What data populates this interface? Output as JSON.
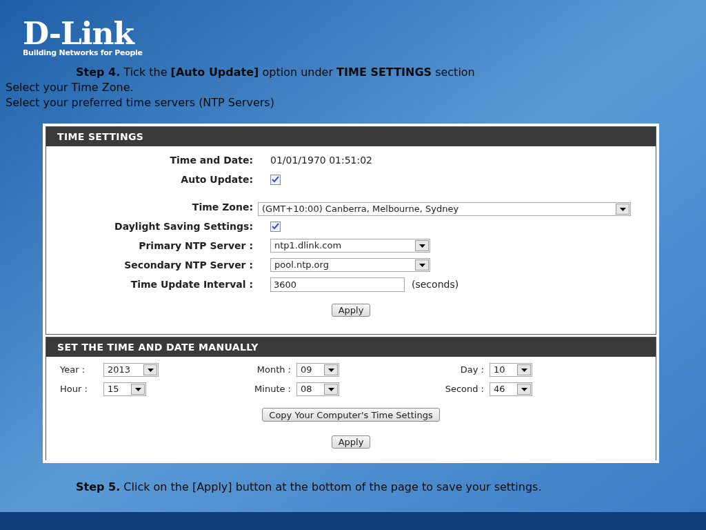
{
  "logo": {
    "name": "D-Link",
    "tagline": "Building Networks for People"
  },
  "instructions": [
    "**Step 4.** Tick the **[Auto Update]** option under **TIME SETTINGS** section",
    "Select your Time Zone.",
    "Select your preferred time servers (NTP Servers)"
  ],
  "time_settings": {
    "title": "TIME SETTINGS",
    "rows": [
      {
        "kind": "text",
        "label": "Time and Date:",
        "value": "01/01/1970 01:51:02"
      },
      {
        "kind": "checkbox",
        "label": "Auto Update:",
        "checked": true
      },
      {
        "kind": "zone",
        "label": "Time Zone:",
        "value": "(GMT+10:00) Canberra, Melbourne, Sydney"
      },
      {
        "kind": "checkbox",
        "label": "Daylight Saving Settings:",
        "checked": true
      },
      {
        "kind": "select",
        "label": "Primary NTP Server :",
        "value": "ntp1.dlink.com"
      },
      {
        "kind": "select",
        "label": "Secondary NTP Server :",
        "value": "pool.ntp.org"
      },
      {
        "kind": "input",
        "label": "Time Update Interval :",
        "value": "3600",
        "suffix": "(seconds)"
      }
    ],
    "apply": "Apply"
  },
  "manual": {
    "title": "SET THE TIME AND DATE MANUALLY",
    "fields": [
      {
        "label": "Year :",
        "value": "2013"
      },
      {
        "label": "Month :",
        "value": "09"
      },
      {
        "label": "Day :",
        "value": "10"
      },
      {
        "label": "Hour :",
        "value": "15"
      },
      {
        "label": "Minute :",
        "value": "08"
      },
      {
        "label": "Second :",
        "value": "46"
      }
    ],
    "copy_button": "Copy Your Computer's Time Settings",
    "apply": "Apply"
  },
  "footer": "**Step 5.** Click on the [Apply] button at the bottom of the page to save your settings."
}
